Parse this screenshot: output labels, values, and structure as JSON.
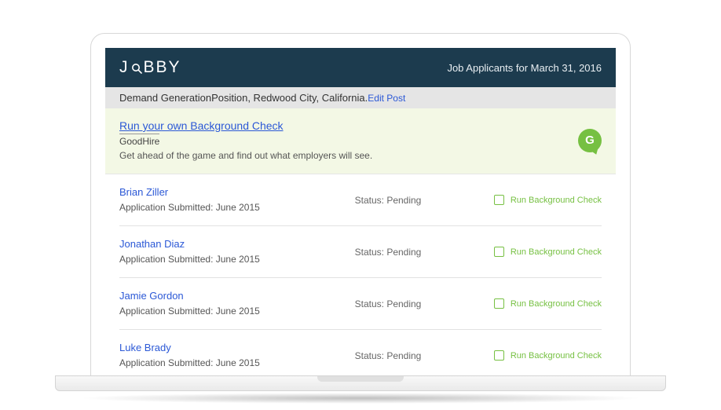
{
  "brand": {
    "name_prefix": "J",
    "name_suffix": "BBY"
  },
  "header": {
    "title": "Job Applicants for March 31, 2016"
  },
  "subheader": {
    "role": "Demand Generation",
    "position_text": "Position, Redwood City, California.",
    "edit_label": "Edit Post"
  },
  "promo": {
    "title": "Run your own Background Check",
    "brand": "GoodHire",
    "description": "Get ahead of the game and find out what employers will see.",
    "badge_letter": "G"
  },
  "labels": {
    "submitted_prefix": "Application Submitted: ",
    "status_prefix": "Status: ",
    "run_check": "Run Background Check"
  },
  "applicants": [
    {
      "name": "Brian Ziller",
      "submitted": "June 2015",
      "status": "Pending"
    },
    {
      "name": "Jonathan Diaz",
      "submitted": "June 2015",
      "status": "Pending"
    },
    {
      "name": "Jamie Gordon",
      "submitted": "June 2015",
      "status": "Pending"
    },
    {
      "name": "Luke Brady",
      "submitted": "June 2015",
      "status": "Pending"
    }
  ]
}
